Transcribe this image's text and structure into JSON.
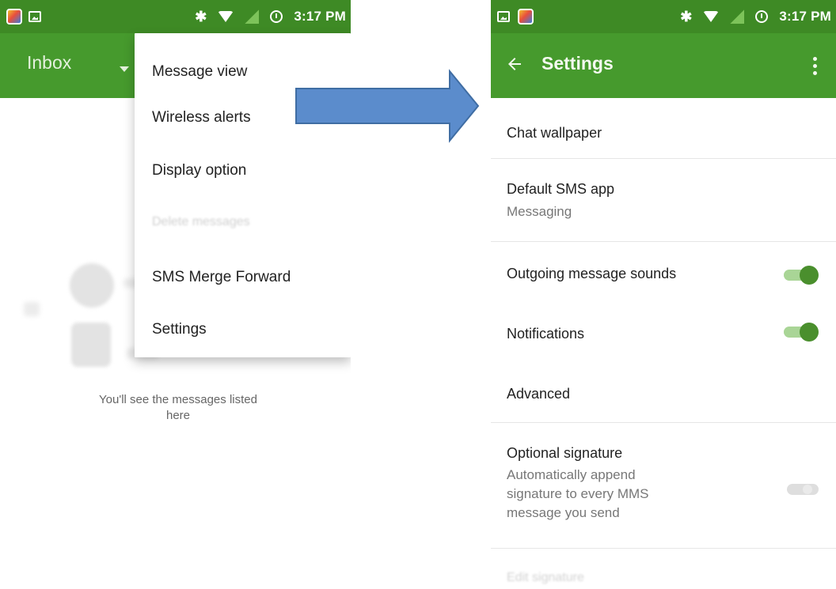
{
  "status_bar": {
    "time": "3:17 PM",
    "bluetooth_icon": "bluetooth-icon",
    "wifi_icon": "wifi-icon",
    "signal_icon": "signal-icon",
    "alarm_icon": "alarm-clock-icon"
  },
  "colors": {
    "status_bar": "#3e8a25",
    "toolbar": "#469a2d",
    "switch_on": "#4a8f2d",
    "arrow_fill": "#5b8ccc"
  },
  "left_screen": {
    "toolbar_title": "Inbox",
    "empty_state_line1": "You'll see the messages listed",
    "empty_state_line2": "here",
    "menu": {
      "items": [
        {
          "label": "Message view",
          "enabled": true
        },
        {
          "label": "Wireless alerts",
          "enabled": true
        },
        {
          "label": "Display option",
          "enabled": true
        },
        {
          "label": "Delete messages",
          "enabled": false
        },
        {
          "label": "SMS Merge Forward",
          "enabled": true
        },
        {
          "label": "Settings",
          "enabled": true
        }
      ]
    }
  },
  "right_screen": {
    "toolbar_title": "Settings",
    "items": [
      {
        "title": "Chat wallpaper"
      },
      {
        "title": "Default SMS app",
        "summary": "Messaging"
      },
      {
        "title": "Outgoing message sounds",
        "switch_on": true
      },
      {
        "title": "Notifications",
        "switch_on": true
      },
      {
        "title": "Advanced"
      },
      {
        "title": "Optional signature",
        "summary_lines": [
          "Automatically append",
          "signature to every MMS",
          "message you send"
        ],
        "switch_on": false
      },
      {
        "title": "Edit signature",
        "enabled": false
      }
    ]
  }
}
